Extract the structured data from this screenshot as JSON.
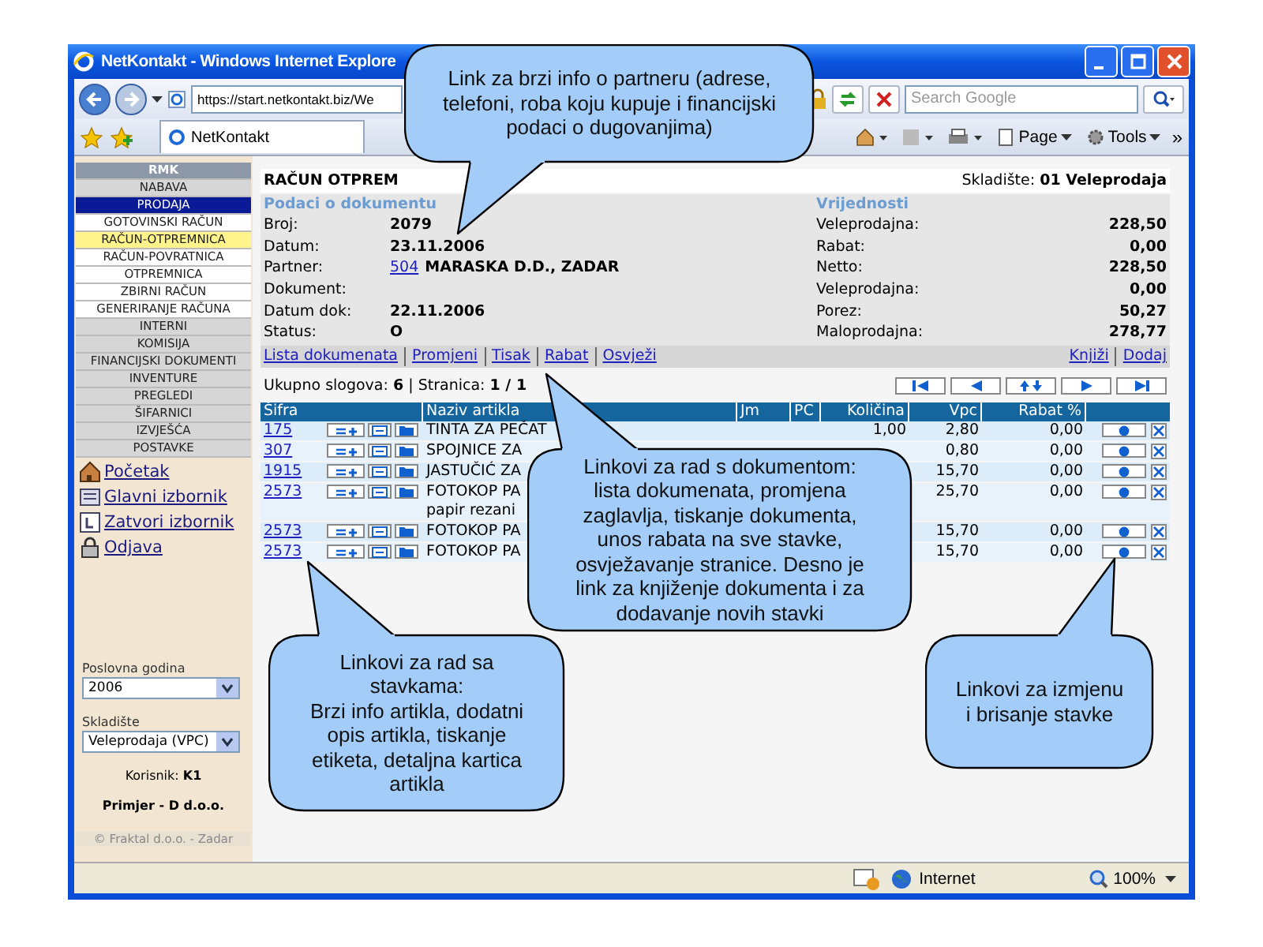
{
  "window": {
    "title": "NetKontakt - Windows Internet Explore",
    "address": "https://start.netkontakt.biz/We",
    "search": {
      "placeholder": "Search Google"
    },
    "tab": "NetKontakt",
    "toolbar": [
      "Page",
      "Tools"
    ],
    "more": "»"
  },
  "sidebar": {
    "header": "RMK",
    "items": [
      {
        "label": "NABAVA",
        "selected": false
      },
      {
        "label": "PRODAJA",
        "selected": true,
        "children": [
          {
            "label": "GOTOVINSKI RAČUN",
            "selected": false
          },
          {
            "label": "RAČUN-OTPREMNICA",
            "selected": true
          },
          {
            "label": "RAČUN-POVRATNICA",
            "selected": false
          },
          {
            "label": "OTPREMNICA",
            "selected": false
          },
          {
            "label": "ZBIRNI RAČUN",
            "selected": false
          },
          {
            "label": "GENERIRANJE RAČUNA",
            "selected": false
          }
        ]
      },
      {
        "label": "INTERNI",
        "selected": false
      },
      {
        "label": "KOMISIJA",
        "selected": false
      },
      {
        "label": "FINANCIJSKI DOKUMENTI",
        "selected": false
      },
      {
        "label": "INVENTURE",
        "selected": false
      },
      {
        "label": "PREGLEDI",
        "selected": false
      },
      {
        "label": "ŠIFARNICI",
        "selected": false
      },
      {
        "label": "IZVJEŠĆA",
        "selected": false
      },
      {
        "label": "POSTAVKE",
        "selected": false
      }
    ],
    "links": [
      {
        "label": "Početak",
        "kind": "home"
      },
      {
        "label": "Glavni izbornik",
        "kind": "menu"
      },
      {
        "label": "Zatvori izbornik",
        "kind": "close"
      },
      {
        "label": "Odjava",
        "kind": "logout"
      }
    ],
    "fields": [
      {
        "label": "Poslovna godina",
        "value": "2006"
      },
      {
        "label": "Skladište",
        "value": "Veleprodaja (VPC)"
      }
    ],
    "user": {
      "label": "Korisnik:",
      "value": "K1"
    },
    "company": "Primjer - D d.o.o.",
    "copyright": "© Fraktal d.o.o. - Zadar"
  },
  "document": {
    "title": "RAČUN OTPREM",
    "warehouse": "Skladište: **01 Veleprodaja**",
    "info_title": "Podaci o dokumentu",
    "info": [
      {
        "label": "Broj:",
        "value": "2079"
      },
      {
        "label": "Datum:",
        "value": "23.11.2006"
      },
      {
        "label": "Partner:",
        "link": "504",
        "value": "MARASKA D.D., ZADAR"
      },
      {
        "label": "Dokument:"
      },
      {
        "label": "Datum dok:",
        "value": "22.11.2006"
      },
      {
        "label": "Status:",
        "value": "O"
      }
    ],
    "values_title": "Vrijednosti",
    "values": [
      {
        "label": "Veleprodajna:",
        "value": "228,50"
      },
      {
        "label": "Rabat:",
        "value": "0,00"
      },
      {
        "label": "Netto:",
        "value": "228,50"
      },
      {
        "label": "Veleprodajna:",
        "value": "0,00"
      },
      {
        "label": "Porez:",
        "value": "50,27"
      },
      {
        "label": "Maloprodajna:",
        "value": "278,77"
      }
    ],
    "links": [
      "Lista dokumenata",
      "Promjeni",
      "Tisak",
      "Rabat",
      "Osvježi"
    ],
    "links_right": [
      "Knjiži",
      "Dodaj"
    ],
    "summary": "Ukupno slogova: **6** | Stranica: **1 / 1**"
  },
  "table": {
    "columns": [
      "Šifra",
      "Naziv artikla",
      "Jm",
      "PC",
      "Količina",
      "Vpc",
      "Rabat %"
    ],
    "rows": [
      {
        "code": "175",
        "name": "TINTA ZA PEČAT",
        "quantity": "1,00",
        "vpc": "2,80",
        "rabat": "0,00"
      },
      {
        "code": "307",
        "name": "SPOJNICE ZA",
        "vpc": "0,80",
        "rabat": "0,00"
      },
      {
        "code": "1915",
        "name": "JASTUČIĆ ZA",
        "vpc": "15,70",
        "rabat": "0,00"
      },
      {
        "code": "2573",
        "name": "FOTOKOP PA",
        "name_2": "papir rezani",
        "vpc": "25,70",
        "rabat": "0,00"
      },
      {
        "code": "2573",
        "name": "FOTOKOP PA",
        "vpc": "15,70",
        "rabat": "0,00"
      },
      {
        "code": "2573",
        "name": "FOTOKOP PA",
        "vpc": "15,70",
        "rabat": "0,00"
      }
    ]
  },
  "status_bar": {
    "zone": "Internet",
    "zoom": "100%"
  },
  "callouts": [
    "Link za brzi info o partneru (adrese,\ntelefoni, roba koju kupuje i financijski\npodaci o dugovanjima)",
    "Linkovi za rad s dokumentom:\nlista dokumenata, promjena\nzaglavlja, tiskanje dokumenta,\nunos rabata na sve stavke,\nosvježavanje stranice. Desno je\nlink za knjiženje dokumenta i za\ndodavanje novih stavki",
    "Linkovi za rad sa\nstavkama:\nBrzi info artikla, dodatni\nopis artikla, tiskanje\netiketa, detaljna kartica\nartikla",
    "Linkovi za izmjenu\ni brisanje stavke"
  ]
}
